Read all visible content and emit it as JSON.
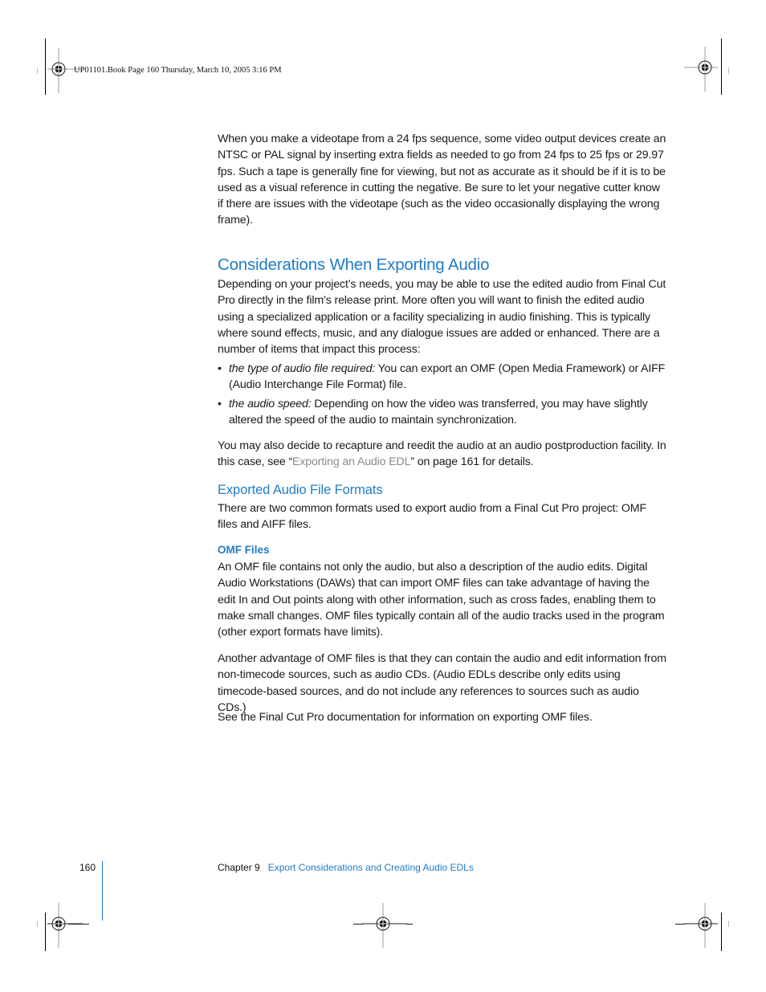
{
  "slug": {
    "text": "UP01101.Book  Page 160  Thursday, March 10, 2005  3:16 PM"
  },
  "content": {
    "intro_paragraph": "When you make a videotape from a 24 fps sequence, some video output devices create an NTSC or PAL signal by inserting extra fields as needed to go from 24 fps to 25 fps or 29.97 fps. Such a tape is generally fine for viewing, but not as accurate as it should be if it is to be used as a visual reference in cutting the negative. Be sure to let your negative cutter know if there are issues with the videotape (such as the video occasionally displaying the wrong frame).",
    "section_heading": "Considerations When Exporting Audio",
    "section_paragraph": "Depending on your project’s needs, you may be able to use the edited audio from Final Cut Pro directly in the film’s release print. More often you will want to finish the edited audio using a specialized application or a facility specializing in audio finishing. This is typically where sound effects, music, and any dialogue issues are added or enhanced. There are a number of items that impact this process:",
    "bullets": [
      {
        "bullet": "•",
        "term": "the type of audio file required:",
        "text": " You can export an OMF (Open Media Framework) or AIFF (Audio Interchange File Format) file."
      },
      {
        "bullet": "•",
        "term": "the audio speed:",
        "text": " Depending on how the video was transferred, you may have slightly altered the speed of the audio to maintain synchronization."
      }
    ],
    "recapture_paragraph": {
      "before": "You may also decide to recapture and reedit the audio at an audio postproduction facility. In this case, see “",
      "link": "Exporting an Audio EDL",
      "after": "” on page 161 for details."
    },
    "subsection_heading": "Exported Audio File Formats",
    "subsection_paragraph": "There are two common formats used to export audio from a Final Cut Pro project: OMF files and AIFF files.",
    "subsubsection_heading": "OMF Files",
    "omf_paragraph_1": "An OMF file contains not only the audio, but also a description of the audio edits. Digital Audio Workstations (DAWs) that can import OMF files can take advantage of having the edit In and Out points along with other information, such as cross fades, enabling them to make small changes. OMF files typically contain all of the audio tracks used in the program (other export formats have limits).",
    "omf_paragraph_2": "Another advantage of OMF files is that they can contain the audio and edit information from non-timecode sources, such as audio CDs. (Audio EDLs describe only edits using timecode-based sources, and do not include any references to sources such as audio CDs.)",
    "omf_paragraph_3": "See the Final Cut Pro documentation for information on exporting OMF files."
  },
  "footer": {
    "page_number": "160",
    "chapter_label": "Chapter 9",
    "chapter_title": "Export Considerations and Creating Audio EDLs"
  },
  "colors": {
    "heading_blue": "#1f7dc8",
    "xref_gray": "#8a8a8a",
    "body_text": "#1a1a1a"
  }
}
